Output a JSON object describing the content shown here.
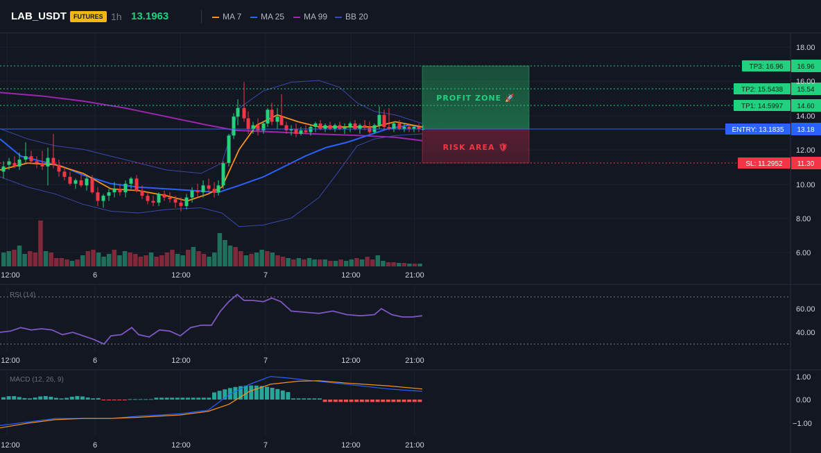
{
  "header": {
    "symbol": "LAB_USDT",
    "badge": "FUTURES",
    "interval": "1h",
    "price": "13.1963",
    "legend": [
      {
        "label": "MA 7",
        "color": "#f7931a",
        "icon": "orange-line-icon"
      },
      {
        "label": "MA 25",
        "color": "#2962ff",
        "icon": "blue-line-icon"
      },
      {
        "label": "MA 99",
        "color": "#9c27b0",
        "icon": "purple-line-icon"
      },
      {
        "label": "BB 20",
        "color": "#3949ab",
        "icon": "navy-line-icon"
      }
    ]
  },
  "price_axis": {
    "ticks": [
      "18.00",
      "16.00",
      "14.00",
      "12.00",
      "10.00",
      "8.00",
      "6.00"
    ]
  },
  "time_axis": {
    "ticks": [
      "12:00",
      "6",
      "12:00",
      "7",
      "12:00",
      "21:00"
    ]
  },
  "levels": [
    {
      "kind": "tp3",
      "tag": "TP3: 16.96",
      "axis": "16.96",
      "value": 16.96,
      "color": "#22d17f"
    },
    {
      "kind": "tp2",
      "tag": "TP2: 15.5438",
      "axis": "15.54",
      "value": 15.5438,
      "color": "#22d17f"
    },
    {
      "kind": "tp1",
      "tag": "TP1: 14.5997",
      "axis": "14.60",
      "value": 14.5997,
      "color": "#22d17f"
    },
    {
      "kind": "entry",
      "tag": "ENTRY: 13.1835",
      "axis": "13.18",
      "value": 13.1835,
      "color": "#2962ff"
    },
    {
      "kind": "sl",
      "tag": "SL: 11.2952",
      "axis": "11.30",
      "value": 11.2952,
      "color": "#f23645"
    }
  ],
  "zones": {
    "profit_label": "PROFIT ZONE 🚀",
    "risk_label": "RISK AREA 🛡"
  },
  "rsi": {
    "title": "RSI (14)",
    "ticks": [
      "60.00",
      "40.00"
    ],
    "upper": 70,
    "lower": 30
  },
  "macd": {
    "title": "MACD (12, 26, 9)",
    "ticks": [
      "1.00",
      "0.00",
      "−1.00"
    ]
  },
  "colors": {
    "up": "#26d07c",
    "down": "#f23645",
    "vol_up": "#1e6f5c",
    "vol_down": "#7f2a3a",
    "bg": "#131722",
    "grid": "#1e222d"
  }
}
